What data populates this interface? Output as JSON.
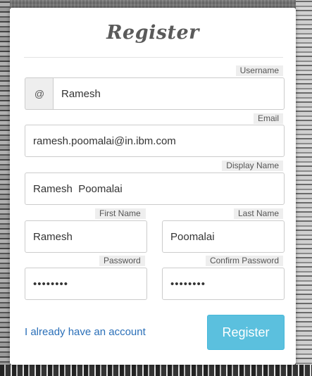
{
  "form": {
    "title": "Register",
    "username": {
      "label": "Username",
      "addon": "@",
      "value": "Ramesh"
    },
    "email": {
      "label": "Email",
      "value": "ramesh.poomalai@in.ibm.com"
    },
    "display_name": {
      "label": "Display Name",
      "value": "Ramesh  Poomalai"
    },
    "first_name": {
      "label": "First Name",
      "value": "Ramesh"
    },
    "last_name": {
      "label": "Last Name",
      "value": "Poomalai"
    },
    "password": {
      "label": "Password",
      "value": "••••••••"
    },
    "confirm_password": {
      "label": "Confirm Password",
      "value": "••••••••"
    },
    "login_link": "I already have an account",
    "submit_label": "Register"
  },
  "colors": {
    "accent": "#5bc0de",
    "link": "#2a6fb8"
  }
}
